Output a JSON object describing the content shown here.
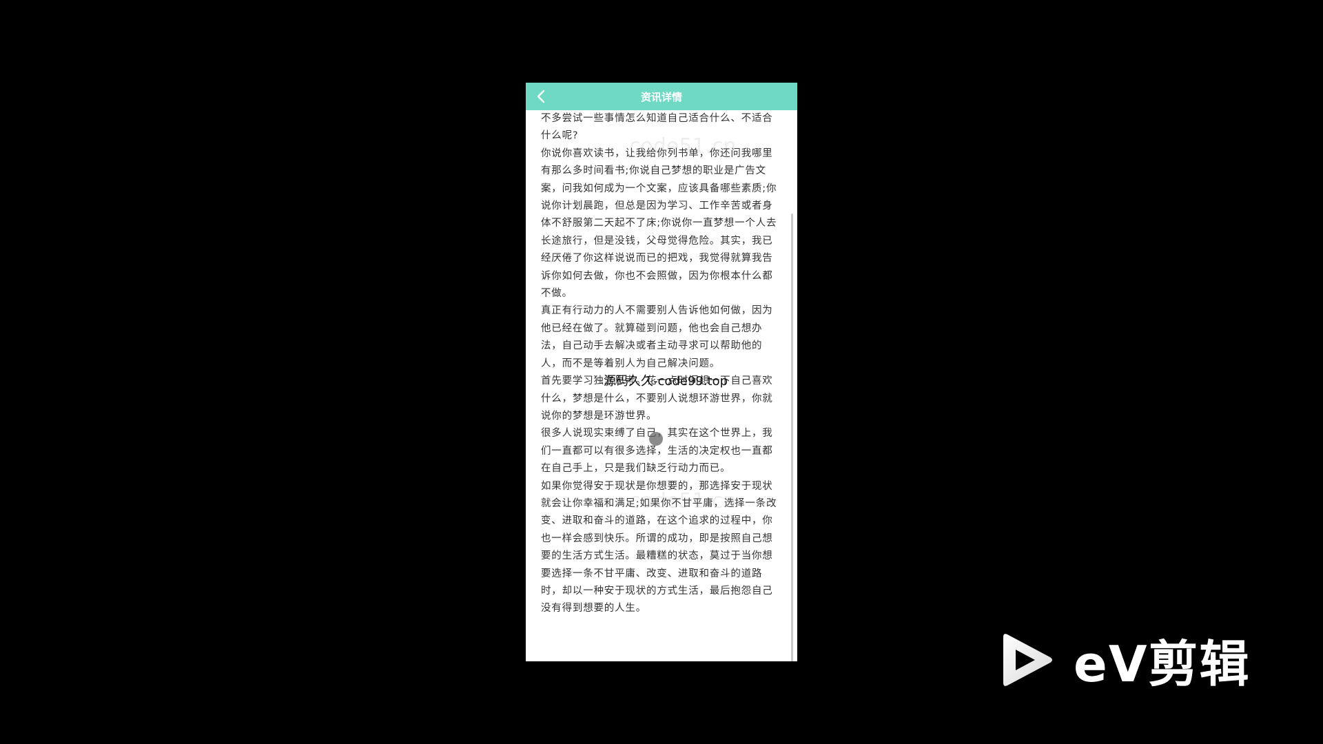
{
  "header": {
    "title": "资讯详情",
    "back_icon": "chevron-left-icon",
    "color": "#6fd9c4"
  },
  "article": {
    "paragraphs": [
      "不多尝试一些事情怎么知道自己适合什么、不适合什么呢?",
      "你说你喜欢读书，让我给你列书单，你还问我哪里有那么多时间看书;你说自己梦想的职业是广告文案，问我如何成为一个文案，应该具备哪些素质;你说你计划晨跑，但总是因为学习、工作辛苦或者身体不舒服第二天起不了床;你说你一直梦想一个人去长途旅行，但是没钱，父母觉得危险。其实，我已经厌倦了你这样说说而已的把戏，我觉得就算我告诉你如何去做，你也不会照做，因为你根本什么都不做。",
      "真正有行动力的人不需要别人告诉他如何做，因为他已经在做了。就算碰到问题，他也会自己想办法，自己动手去解决或者主动寻求可以帮助他的人，而不是等着别人为自己解决问题。",
      "首先要学习独立思考。花一点时间想一下自己喜欢什么，梦想是什么，不要别人说想环游世界，你就说你的梦想是环游世界。",
      "很多人说现实束缚了自己，其实在这个世界上，我们一直都可以有很多选择，生活的决定权也一直都在自己手上，只是我们缺乏行动力而已。",
      "如果你觉得安于现状是你想要的，那选择安于现状就会让你幸福和满足;如果你不甘平庸，选择一条改变、进取和奋斗的道路，在这个追求的过程中，你也一样会感到快乐。所谓的成功，即是按照自己想要的生活方式生活。最糟糕的状态，莫过于当你想要选择一条不甘平庸、改变、进取和奋斗的道路时，却以一种安于现状的方式生活，最后抱怨自己没有得到想要的人生。"
    ]
  },
  "watermarks": {
    "faint": "code51.cn",
    "overlay": "源码久久-code99.top"
  },
  "branding": {
    "logo_text": "eV剪辑",
    "logo_icon": "play-icon"
  }
}
